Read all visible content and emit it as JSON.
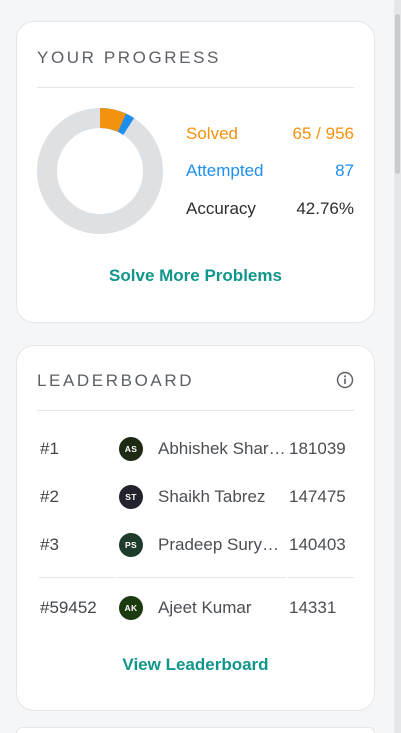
{
  "progress": {
    "title": "YOUR PROGRESS",
    "solved_label": "Solved",
    "solved_value": "65 / 956",
    "attempted_label": "Attempted",
    "attempted_value": "87",
    "accuracy_label": "Accuracy",
    "accuracy_value": "42.76%",
    "solved_count": 65,
    "attempted_count": 87,
    "total": 956,
    "colors": {
      "solved": "#f2920d",
      "attempted": "#1f8fef",
      "remaining": "#dde1e4",
      "accuracy": "#2b2f33"
    },
    "cta_label": "Solve More Problems"
  },
  "leaderboard": {
    "title": "LEADERBOARD",
    "info_icon": "info-circle-icon",
    "rows": [
      {
        "rank": "#1",
        "initials": "AS",
        "name": "Abhishek Shar…",
        "score": "181039",
        "avatar_color": "#1f2a14"
      },
      {
        "rank": "#2",
        "initials": "ST",
        "name": "Shaikh Tabrez",
        "score": "147475",
        "avatar_color": "#23232d"
      },
      {
        "rank": "#3",
        "initials": "PS",
        "name": "Pradeep Sury…",
        "score": "140403",
        "avatar_color": "#1f3b2c"
      }
    ],
    "user_row": {
      "rank": "#59452",
      "initials": "AK",
      "name": "Ajeet Kumar",
      "score": "14331",
      "avatar_color": "#1c3a10"
    },
    "cta_label": "View Leaderboard"
  },
  "accent": "#11968b"
}
